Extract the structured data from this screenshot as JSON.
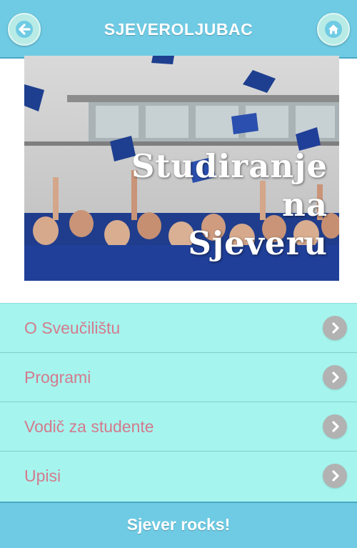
{
  "header": {
    "title": "SJEVEROLJUBAC",
    "back_icon": "back-arrow-icon",
    "home_icon": "home-icon"
  },
  "hero": {
    "lines": [
      "Studiranje",
      "na",
      "Sjeveru"
    ]
  },
  "menu": {
    "items": [
      {
        "label": "O Sveučilištu",
        "icon": "chevron-right-icon"
      },
      {
        "label": "Programi",
        "icon": "chevron-right-icon"
      },
      {
        "label": "Vodič za studente",
        "icon": "chevron-right-icon"
      },
      {
        "label": "Upisi",
        "icon": "chevron-right-icon"
      }
    ]
  },
  "footer": {
    "text": "Sjever rocks!"
  },
  "colors": {
    "header_bg": "#6fcbe4",
    "menu_bg": "#a5f5ee",
    "menu_text": "#d47a8c",
    "chevron_bg": "#b2b2b2"
  }
}
